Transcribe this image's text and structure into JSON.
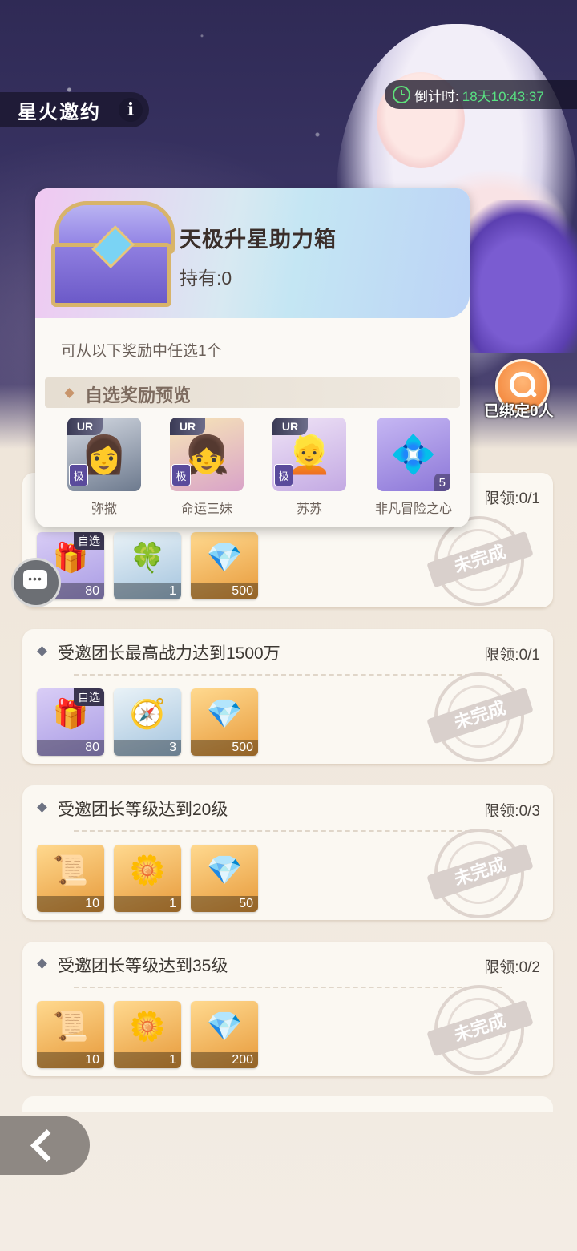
{
  "header": {
    "title": "星火邀约",
    "countdown_label": "倒计时:",
    "countdown_value": "18天10:43:37"
  },
  "side": {
    "bound_label": "已绑定0人"
  },
  "popup": {
    "title": "天极升星助力箱",
    "held": "持有:0",
    "subtitle": "可从以下奖励中任选1个",
    "preview_title": "自选奖励预览",
    "rewards": [
      {
        "name": "弥撒",
        "rarity": "UR",
        "tier": "极"
      },
      {
        "name": "命运三妹",
        "rarity": "UR",
        "tier": "极"
      },
      {
        "name": "苏苏",
        "rarity": "UR",
        "tier": "极"
      },
      {
        "name": "非凡冒险之心",
        "qty": "5"
      }
    ]
  },
  "tasks": [
    {
      "title": "",
      "limit": "限领:0/1",
      "status": "未完成",
      "items": [
        {
          "tag": "自选",
          "qty": "80"
        },
        {
          "qty": "1"
        },
        {
          "qty": "500"
        }
      ]
    },
    {
      "title": "受邀团长最高战力达到1500万",
      "limit": "限领:0/1",
      "status": "未完成",
      "items": [
        {
          "tag": "自选",
          "qty": "80"
        },
        {
          "qty": "3"
        },
        {
          "qty": "500"
        }
      ]
    },
    {
      "title": "受邀团长等级达到20级",
      "limit": "限领:0/3",
      "status": "未完成",
      "items": [
        {
          "qty": "10"
        },
        {
          "qty": "1"
        },
        {
          "qty": "50"
        }
      ]
    },
    {
      "title": "受邀团长等级达到35级",
      "limit": "限领:0/2",
      "status": "未完成",
      "items": [
        {
          "qty": "10"
        },
        {
          "qty": "1"
        },
        {
          "qty": "200"
        }
      ]
    }
  ],
  "colors": {
    "countdown_value": "#58e282",
    "accent_orange": "#f07b2e",
    "stamp": "#d8ceca"
  }
}
